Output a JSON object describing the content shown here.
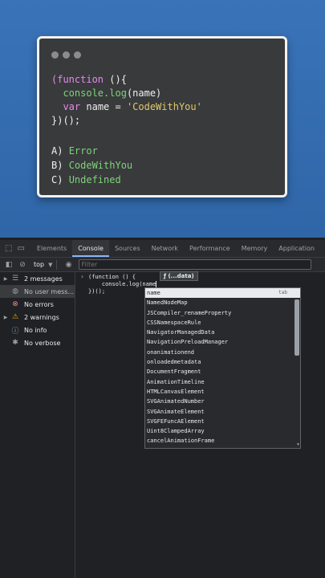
{
  "card": {
    "code": {
      "line1_open": "(function ",
      "line1_rest": "(){",
      "line2_fn": "console.log",
      "line2_rest": "(name)",
      "line3_kw": "var",
      "line3_mid": " name = ",
      "line3_str": "'CodeWithYou'",
      "line4": "})();"
    },
    "answers": [
      {
        "letter": "A)",
        "text": "Error"
      },
      {
        "letter": "B)",
        "text": "CodeWithYou"
      },
      {
        "letter": "C)",
        "text": "Undefined"
      }
    ]
  },
  "devtools": {
    "tabs": [
      "Elements",
      "Console",
      "Sources",
      "Network",
      "Performance",
      "Memory",
      "Application",
      "Se"
    ],
    "active_tab": "Console",
    "toolbar": {
      "context": "top",
      "filter_placeholder": "Filter"
    },
    "sidebar": [
      {
        "label": "2 messages",
        "icon": "list-icon",
        "expandable": true
      },
      {
        "label": "No user mess...",
        "icon": "user-icon",
        "expandable": false,
        "selected": true
      },
      {
        "label": "No errors",
        "icon": "error-icon",
        "expandable": false
      },
      {
        "label": "2 warnings",
        "icon": "warning-icon",
        "expandable": true
      },
      {
        "label": "No info",
        "icon": "info-icon",
        "expandable": false
      },
      {
        "label": "No verbose",
        "icon": "bug-icon",
        "expandable": false
      }
    ],
    "console": {
      "line1": "(function () {",
      "line2": "    console.log(name",
      "line3": "})();",
      "hint": "ƒ (...data)"
    },
    "autocomplete": {
      "selected": "name",
      "tab_hint": "tab",
      "items": [
        "NamedNodeMap",
        "JSCompiler_renameProperty",
        "CSSNamespaceRule",
        "NavigatorManagedData",
        "NavigationPreloadManager",
        "onanimationend",
        "onloadedmetadata",
        "DocumentFragment",
        "AnimationTimeline",
        "HTMLCanvasElement",
        "SVGAnimatedNumber",
        "SVGAnimateElement",
        "SVGFEFuncAElement",
        "Uint8ClampedArray",
        "cancelAnimationFrame"
      ]
    },
    "colors": {
      "background": "#202124",
      "accent": "#8ab4f8",
      "warning": "#f2a600",
      "error": "#f28b82"
    }
  }
}
